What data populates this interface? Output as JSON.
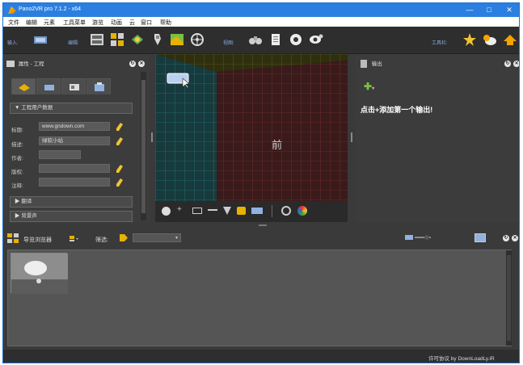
{
  "window": {
    "title": "Pano2VR pro 7.1.2 - x64"
  },
  "menu": [
    "文件",
    "编辑",
    "元素",
    "工具菜单",
    "游览",
    "动画",
    "云",
    "窗口",
    "帮助"
  ],
  "toolbar": {
    "input_label": "输入:",
    "edit_label": "编辑:",
    "view_label": "视图:",
    "toolbar_label": "工具栏:"
  },
  "properties": {
    "title": "属性 - 工程",
    "section_user_data": "工程用户数据",
    "fields": [
      {
        "label": "标题:",
        "value": "www.gndown.com"
      },
      {
        "label": "描述:",
        "value": "绿软小站"
      },
      {
        "label": "作者:",
        "value": ""
      },
      {
        "label": "版权:",
        "value": ""
      },
      {
        "label": "注释:",
        "value": ""
      }
    ],
    "section_translate": "翻译",
    "section_bgsound": "背景声"
  },
  "viewport": {
    "face_label": "前"
  },
  "output": {
    "title": "输出",
    "prompt": "点击+添加第一个输出!"
  },
  "browser": {
    "title": "导览浏览器",
    "filter_label": "筛选:"
  },
  "status": {
    "text": "许可协议 by DownLoadLy.iR"
  },
  "colors": {
    "titlebar": "#2b7fe0",
    "panel": "#3c3c3c",
    "accent_green": "#7bc043"
  }
}
